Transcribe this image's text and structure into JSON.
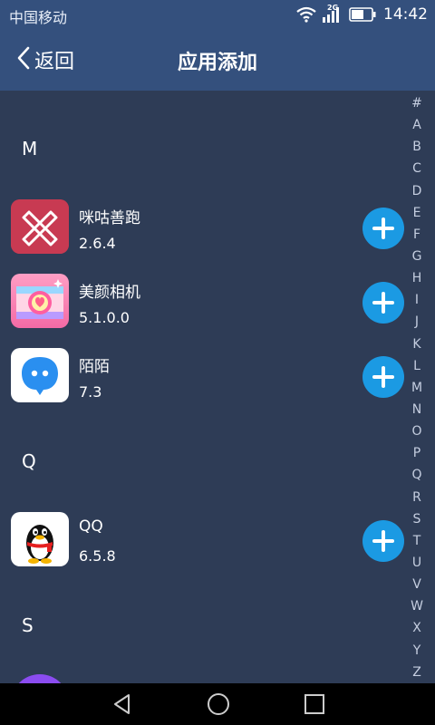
{
  "status_bar": {
    "carrier": "中国移动",
    "network": "2G",
    "time": "14:42",
    "icons": [
      "wifi-icon",
      "signal-icon",
      "battery-icon"
    ]
  },
  "header": {
    "back_label": "返回",
    "title": "应用添加"
  },
  "sections": [
    {
      "letter": "M",
      "apps": [
        {
          "name": "咪咕善跑",
          "version": "2.6.4",
          "icon": "migu-run-icon"
        },
        {
          "name": "美颜相机",
          "version": "5.1.0.0",
          "icon": "beauty-camera-icon"
        },
        {
          "name": "陌陌",
          "version": "7.3",
          "icon": "momo-icon"
        }
      ]
    },
    {
      "letter": "Q",
      "apps": [
        {
          "name": "QQ",
          "version": "6.5.8",
          "icon": "qq-penguin-icon"
        }
      ]
    },
    {
      "letter": "S",
      "apps": []
    }
  ],
  "index_letters": [
    "#",
    "A",
    "B",
    "C",
    "D",
    "E",
    "F",
    "G",
    "H",
    "I",
    "J",
    "K",
    "L",
    "M",
    "N",
    "O",
    "P",
    "Q",
    "R",
    "S",
    "T",
    "U",
    "V",
    "W",
    "X",
    "Y",
    "Z"
  ],
  "nav": {
    "buttons": [
      "back-triangle-icon",
      "home-circle-icon",
      "recents-square-icon"
    ]
  },
  "colors": {
    "header_bg": "#34507d",
    "list_bg": "#2e3c56",
    "add_button": "#1b9ae3",
    "nav_bg": "#000000"
  }
}
